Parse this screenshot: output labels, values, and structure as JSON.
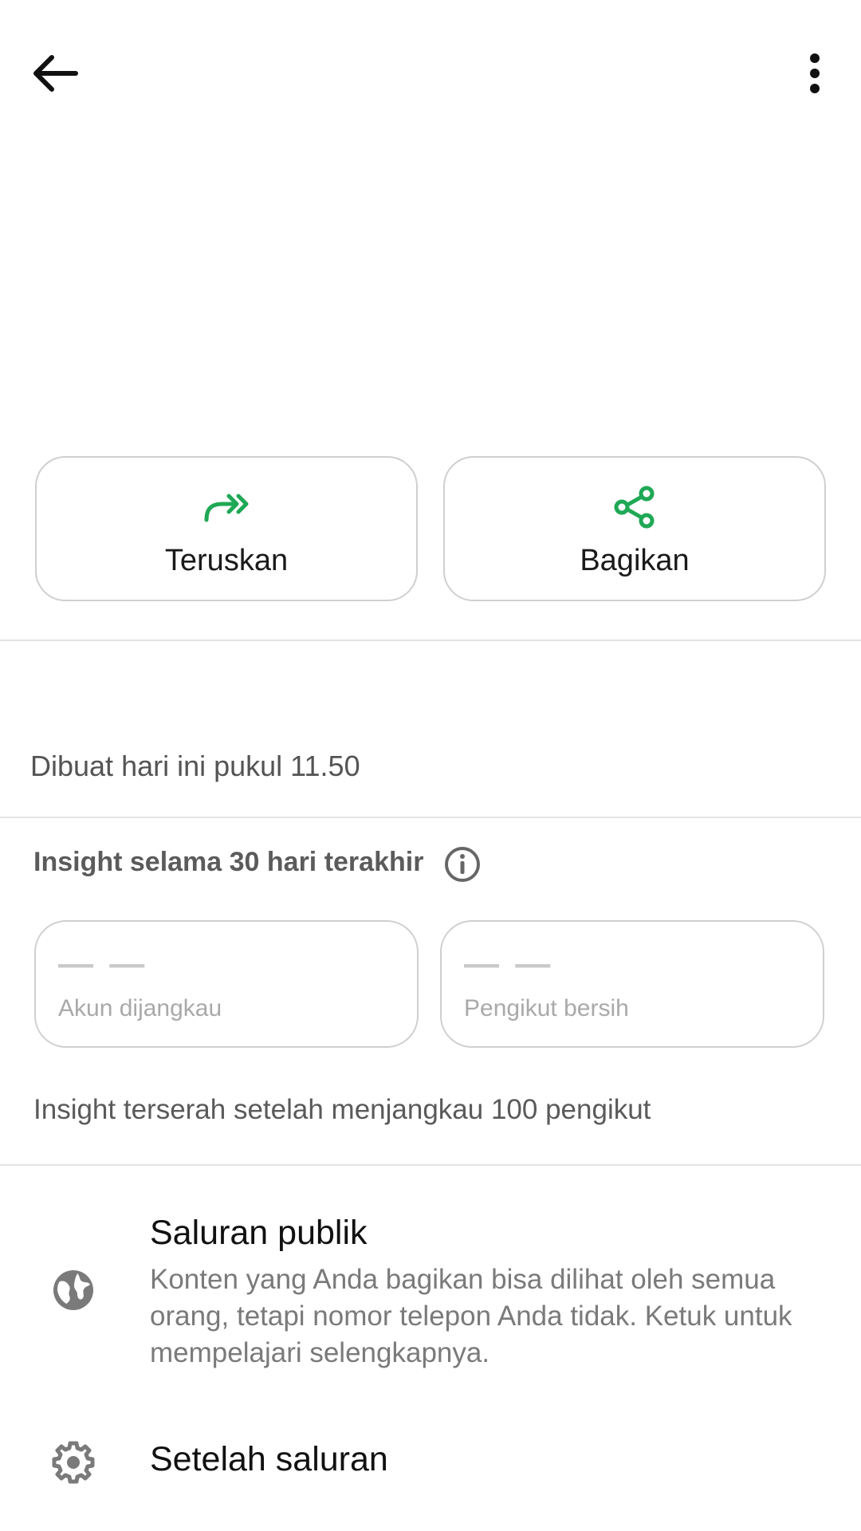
{
  "actions": {
    "forward_label": "Teruskan",
    "share_label": "Bagikan"
  },
  "info": {
    "created": "Dibuat hari ini pukul 11.50"
  },
  "insights": {
    "title": "Insight selama 30 hari terakhir",
    "stats": [
      {
        "value": "— —",
        "caption": "Akun dijangkau"
      },
      {
        "value": "— —",
        "caption": "Pengikut bersih"
      }
    ],
    "note": "Insight terserah setelah menjangkau 100 pengikut"
  },
  "settings": {
    "public": {
      "title": "Saluran publik",
      "description": "Konten yang Anda bagikan bisa dilihat oleh semua orang, tetapi nomor telepon Anda tidak. Ketuk untuk mempelajari selengkapnya."
    },
    "channel_settings": {
      "title": "Setelah saluran"
    }
  },
  "colors": {
    "accent": "#1fa855",
    "icon_gray": "#7a7a7a"
  },
  "icons": {
    "back": "arrow-left-icon",
    "more": "more-vertical-icon",
    "forward": "forward-icon",
    "share": "share-icon",
    "info": "info-icon",
    "globe": "globe-icon",
    "gear": "gear-icon"
  }
}
